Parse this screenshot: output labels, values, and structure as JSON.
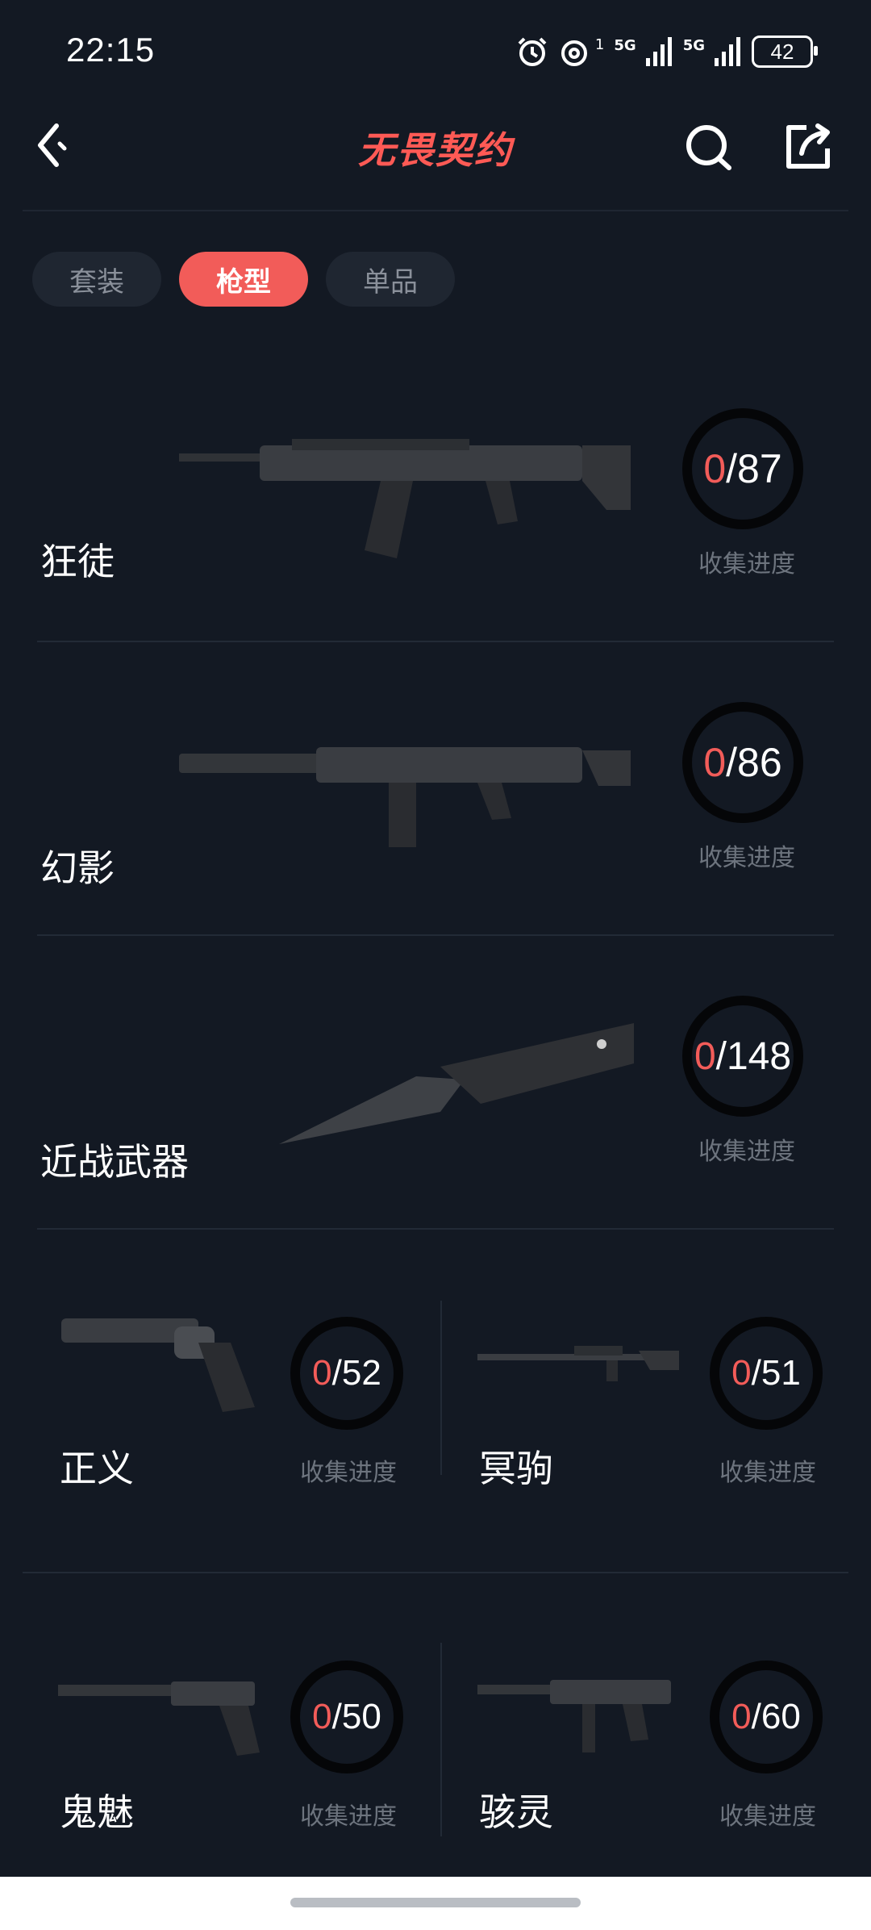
{
  "status": {
    "time": "22:15",
    "network_1": "5G",
    "network_2": "5G",
    "sim_index": "1",
    "battery": "42"
  },
  "header": {
    "title": "无畏契约"
  },
  "tabs": [
    {
      "label": "套装",
      "active": false
    },
    {
      "label": "枪型",
      "active": true
    },
    {
      "label": "单品",
      "active": false
    }
  ],
  "weapons": [
    {
      "name": "狂徒",
      "collected": "0",
      "total": "/87",
      "caption": "收集进度"
    },
    {
      "name": "幻影",
      "collected": "0",
      "total": "/86",
      "caption": "收集进度"
    },
    {
      "name": "近战武器",
      "collected": "0",
      "total": "/148",
      "caption": "收集进度"
    },
    {
      "name": "正义",
      "collected": "0",
      "total": "/52",
      "caption": "收集进度"
    },
    {
      "name": "冥驹",
      "collected": "0",
      "total": "/51",
      "caption": "收集进度"
    },
    {
      "name": "鬼魅",
      "collected": "0",
      "total": "/50",
      "caption": "收集进度"
    },
    {
      "name": "骇灵",
      "collected": "0",
      "total": "/60",
      "caption": "收集进度"
    }
  ],
  "colors": {
    "background": "#131923",
    "accent": "#f25c59",
    "caption": "#6d747e"
  },
  "icons": [
    "back-chevron-icon",
    "search-icon",
    "share-icon",
    "alarm-icon",
    "signal-icon",
    "battery-icon"
  ]
}
